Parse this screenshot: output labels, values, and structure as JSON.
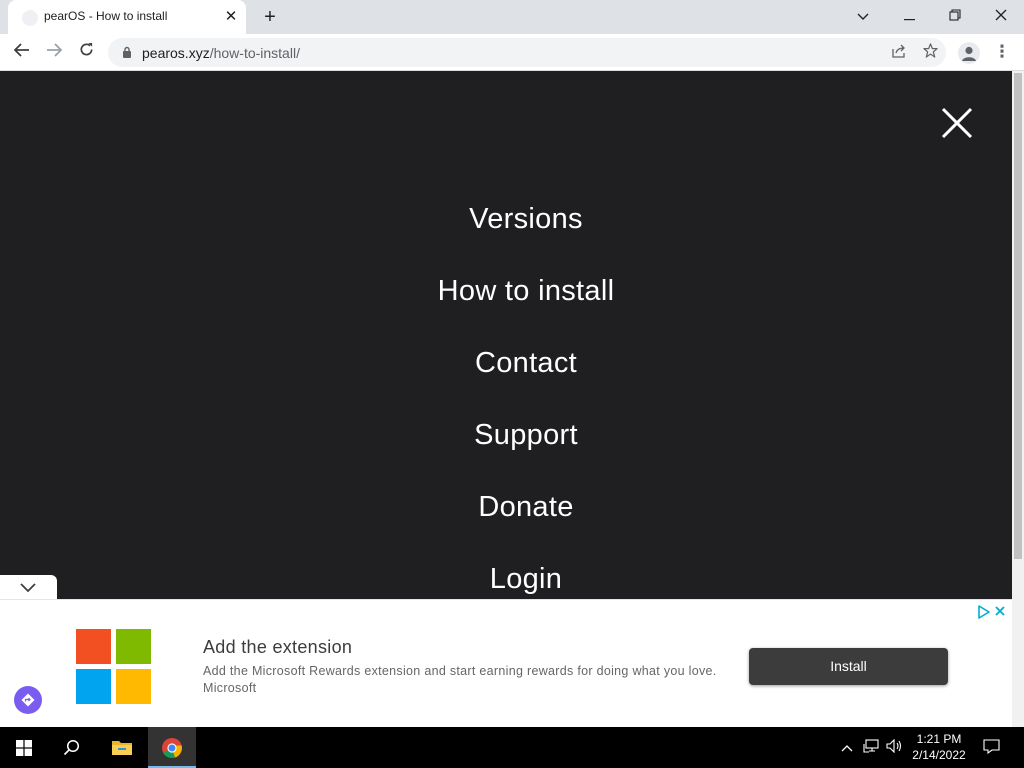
{
  "browser": {
    "tab": {
      "title": "pearOS - How to install",
      "close_icon": "close-icon"
    },
    "new_tab_icon": "plus-icon",
    "window_controls": [
      "chevron-down-icon",
      "minimize-icon",
      "restore-icon",
      "close-icon"
    ],
    "address": {
      "host": "pearos.xyz",
      "path": "/how-to-install/"
    }
  },
  "page": {
    "close_menu_icon": "close-icon",
    "menu": [
      {
        "label": "Versions"
      },
      {
        "label": "How to install"
      },
      {
        "label": "Contact"
      },
      {
        "label": "Support"
      },
      {
        "label": "Donate"
      },
      {
        "label": "Login"
      }
    ],
    "background_color": "#1f1e20"
  },
  "ad": {
    "title": "Add the extension",
    "description": "Add the Microsoft Rewards extension and start earning rewards for doing what you love. Microsoft",
    "button_label": "Install",
    "logo_colors": [
      "#f25022",
      "#7fba00",
      "#00a4ef",
      "#ffb900"
    ]
  },
  "taskbar": {
    "time": "1:21 PM",
    "date": "2/14/2022"
  }
}
